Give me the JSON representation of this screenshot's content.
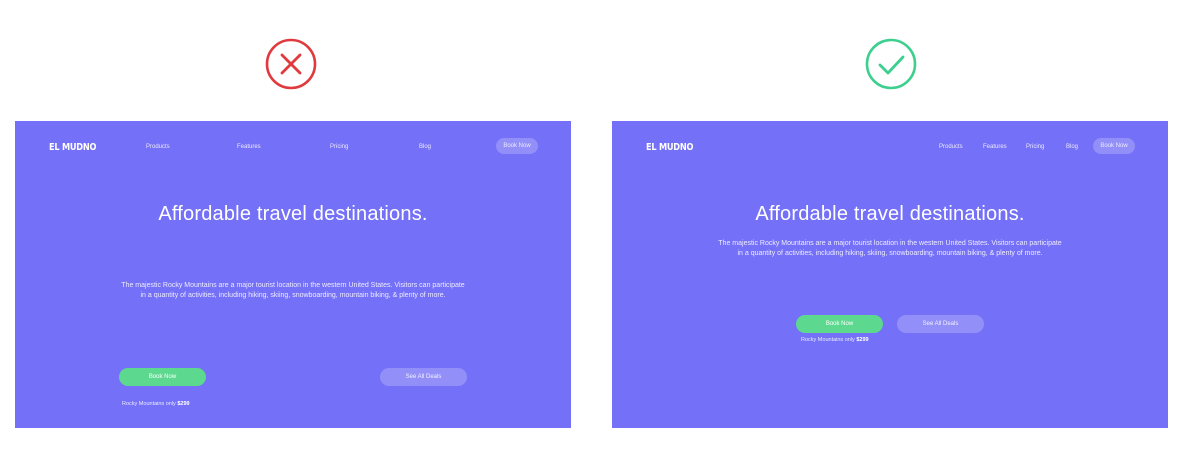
{
  "colors": {
    "background": "#7470f7",
    "primary_button": "#5cd88f",
    "bad_mark": "#e0393e",
    "good_mark": "#3ccf8e"
  },
  "icons": {
    "bad": "x-circle-icon",
    "good": "check-circle-icon"
  },
  "examples": {
    "bad": {
      "logo": "EL MUDNO",
      "nav": [
        "Products",
        "Features",
        "Pricing",
        "Blog"
      ],
      "nav_button": "Book Now",
      "headline": "Affordable travel destinations.",
      "body": "The majestic Rocky Mountains are a major tourist location in the western United States. Visitors can participate in a quantity of activities, including hiking, skiing, snowboarding, mountain biking, & plenty of more.",
      "primary_button": "Book Now",
      "secondary_button": "See All Deals",
      "price_prefix": "Rocky Mountains only",
      "price": "$299"
    },
    "good": {
      "logo": "EL MUDNO",
      "nav": [
        "Products",
        "Features",
        "Pricing",
        "Blog"
      ],
      "nav_button": "Book Now",
      "headline": "Affordable travel destinations.",
      "body": "The majestic Rocky Mountains are a major tourist location in the western United States. Visitors can participate in a quantity of activities, including hiking, skiing, snowboarding, mountain biking, & plenty of more.",
      "primary_button": "Book Now",
      "secondary_button": "See All Deals",
      "price_prefix": "Rocky Mountains only",
      "price": "$299"
    }
  }
}
